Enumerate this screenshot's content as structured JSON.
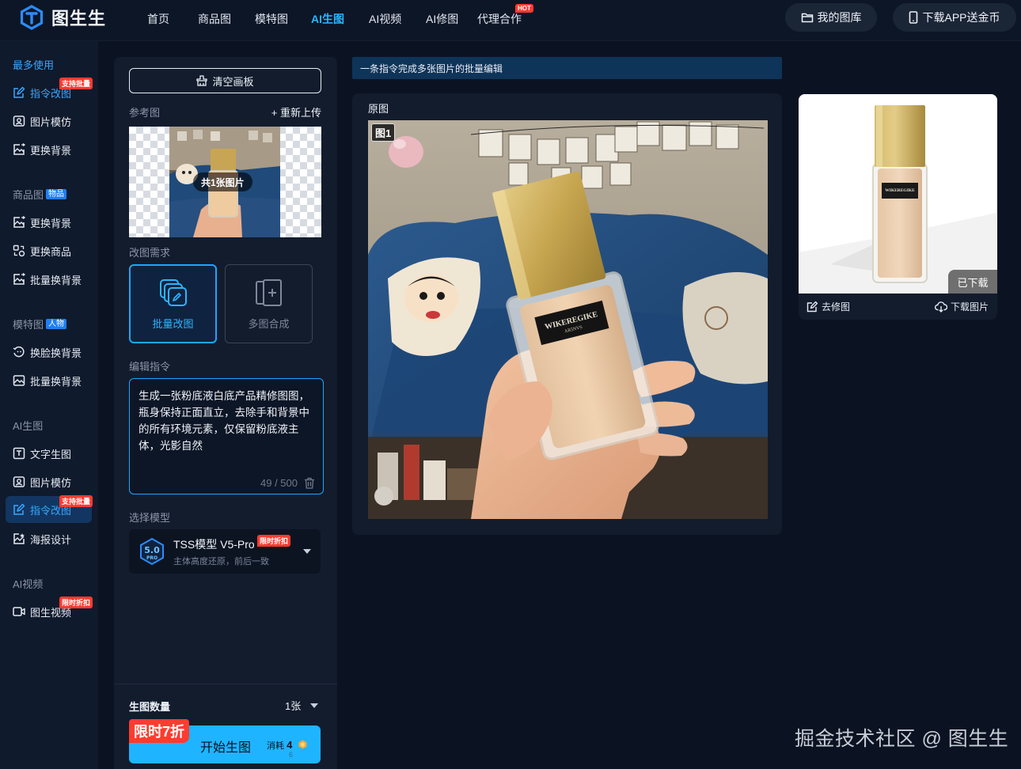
{
  "app": {
    "name": "图生生"
  },
  "nav": {
    "items": [
      "首页",
      "商品图",
      "模特图",
      "AI生图",
      "AI视频",
      "AI修图",
      "代理合作"
    ],
    "active_index": 3,
    "hot_badge": "HOT",
    "my_library": "我的图库",
    "download_app": "下载APP送金币"
  },
  "sidebar": {
    "sections": [
      {
        "title": "最多使用",
        "tag": ""
      },
      {
        "title": "商品图",
        "tag": "物品"
      },
      {
        "title": "模特图",
        "tag": "人物"
      },
      {
        "title": "AI生图",
        "tag": ""
      },
      {
        "title": "AI视频",
        "tag": ""
      }
    ],
    "items": [
      {
        "label": "指令改图",
        "badge": "支持批量"
      },
      {
        "label": "图片模仿"
      },
      {
        "label": "更换背景"
      },
      {
        "label": "更换背景"
      },
      {
        "label": "更换商品"
      },
      {
        "label": "批量换背景"
      },
      {
        "label": "换脸换背景"
      },
      {
        "label": "批量换背景"
      },
      {
        "label": "文字生图"
      },
      {
        "label": "图片模仿"
      },
      {
        "label": "指令改图",
        "badge": "支持批量"
      },
      {
        "label": "海报设计"
      },
      {
        "label": "图生视频",
        "badge": "限时折扣"
      }
    ]
  },
  "panel": {
    "clear_canvas": "清空画板",
    "reference_label": "参考图",
    "reupload": "+ 重新上传",
    "reference_count": "共1张图片",
    "edit_need_label": "改图需求",
    "modes": [
      "批量改图",
      "多图合成"
    ],
    "instruction_label": "编辑指令",
    "instruction_text": "生成一张粉底液白底产品精修图图，瓶身保持正面直立，去除手和背景中的所有环境元素，仅保留粉底液主体，光影自然",
    "instruction_count": "49 / 500",
    "model_label": "选择模型",
    "model_name": "TSS模型 V5-Pro",
    "model_badge": "限时折扣",
    "model_desc": "主体高度还原，前后一致",
    "model_icon_text": "5.0",
    "model_icon_sub": "PRO",
    "quantity_label": "生图数量",
    "quantity_value": "1张",
    "generate_label": "开始生图",
    "generate_cost_label": "消耗",
    "generate_cost": "4",
    "generate_cost_sub": "6",
    "promo": "限时7折"
  },
  "main": {
    "banner": "一条指令完成多张图片的批量编辑",
    "original_title": "原图",
    "image_tag": "图1",
    "product_label": "WIKEREGIKE",
    "product_sublabel": "AR5NVS"
  },
  "result": {
    "status": "已下载",
    "retouch": "去修图",
    "download": "下载图片",
    "product_label": "WIKEREGIKE"
  },
  "watermark": "掘金技术社区 @ 图生生",
  "colors": {
    "accent": "#1fb4ff",
    "badge_red": "#ff3b30",
    "bg": "#0b1322",
    "panel": "#121c2d"
  }
}
